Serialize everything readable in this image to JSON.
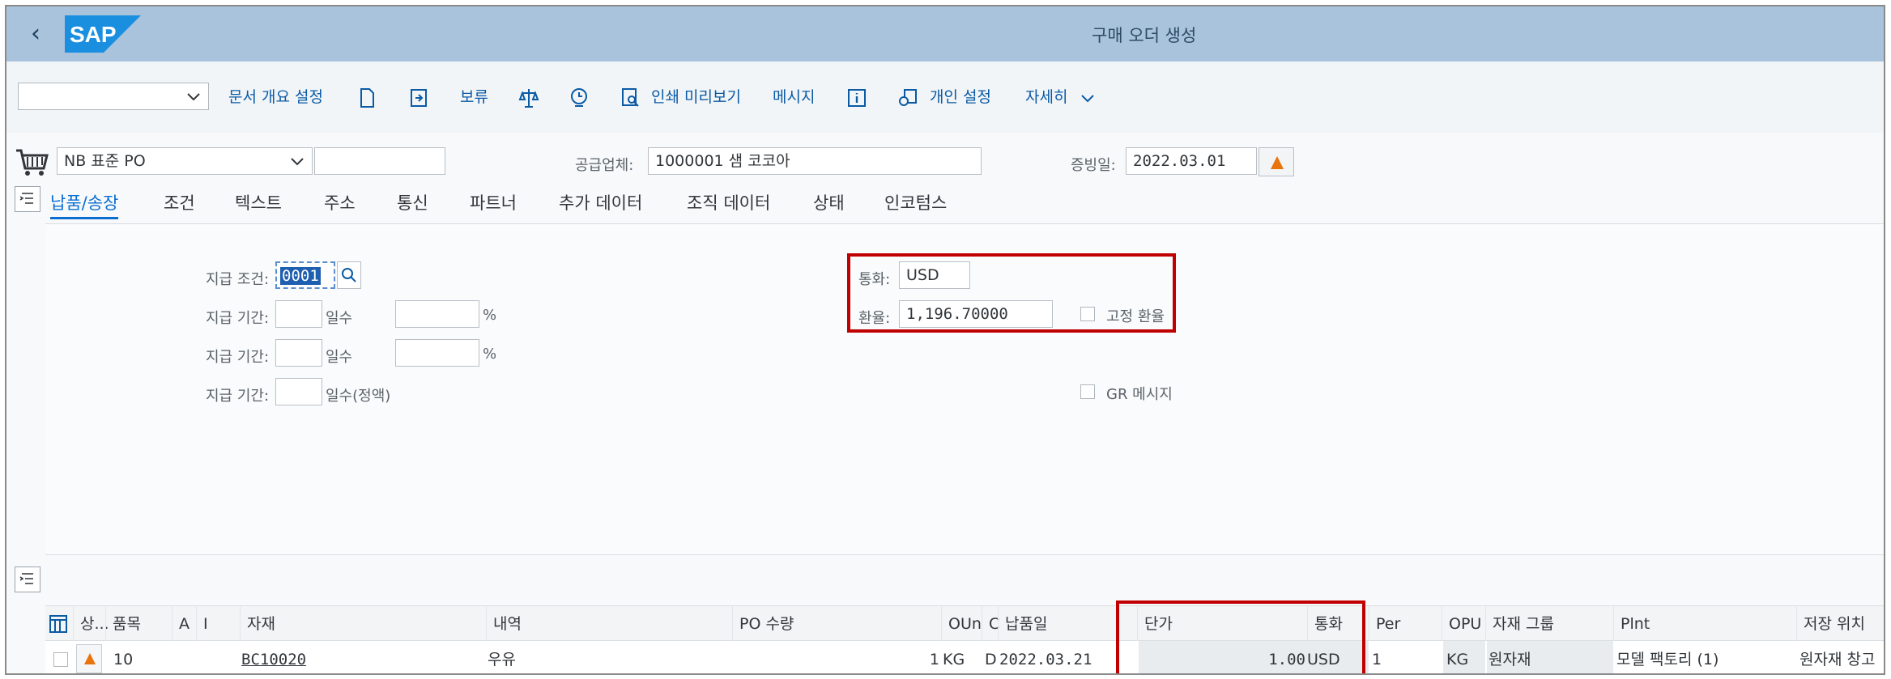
{
  "header": {
    "title": "구매 오더 생성",
    "back_icon": "chevron-left-icon",
    "logo": "SAP"
  },
  "toolbar": {
    "command_value": "",
    "doc_overview": "문서 개요 설정",
    "hold": "보류",
    "print_preview": "인쇄 미리보기",
    "messages": "메시지",
    "personal_settings": "개인 설정",
    "more": "자세히"
  },
  "doc_header": {
    "order_type": "NB 표준 PO",
    "po_number": "",
    "vendor_label": "공급업체:",
    "vendor_value": "1000001 샘 코코아",
    "doc_date_label": "증빙일:",
    "doc_date_value": "2022.03.01"
  },
  "tabs": [
    {
      "label": "납품/송장"
    },
    {
      "label": "조건"
    },
    {
      "label": "텍스트"
    },
    {
      "label": "주소"
    },
    {
      "label": "통신"
    },
    {
      "label": "파트너"
    },
    {
      "label": "추가 데이터"
    },
    {
      "label": "조직 데이터"
    },
    {
      "label": "상태"
    },
    {
      "label": "인코텀스"
    }
  ],
  "delivery": {
    "payment_terms_label": "지급 조건:",
    "payment_terms_value": "0001",
    "period_label": "지급 기간:",
    "days_label": "일수",
    "net_days_label": "일수(정액)",
    "percent": "%",
    "currency_label": "통화:",
    "currency_value": "USD",
    "exchange_rate_label": "환율:",
    "exchange_rate_value": "1,196.70000",
    "fixed_rate_label": "고정 환율",
    "gr_message_label": "GR 메시지"
  },
  "table": {
    "columns": [
      "상...",
      "품목",
      "A",
      "I",
      "자재",
      "내역",
      "PO 수량",
      "OUn",
      "C",
      "납품일",
      "단가",
      "통화",
      "Per",
      "OPU",
      "자재 그룹",
      "Plnt",
      "저장 위치"
    ],
    "rows": [
      {
        "item": "10",
        "material": "BC10020",
        "description": "우유",
        "qty": "1",
        "oun": "KG",
        "c": "D",
        "delivery_date": "2022.03.21",
        "price": "1.00",
        "currency": "USD",
        "per": "1",
        "opu": "KG",
        "mat_group": "원자재",
        "plant": "모델 팩토리 (1)",
        "storage": "원자재 창고"
      }
    ]
  },
  "colors": {
    "header_bg": "#a9c3dc",
    "accent": "#0a6ed1",
    "highlight": "#c00000",
    "warning": "#e9730c"
  }
}
